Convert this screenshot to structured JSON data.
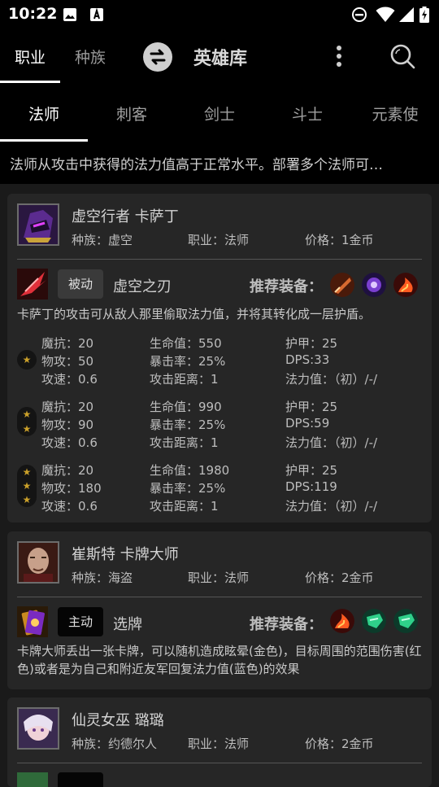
{
  "status_bar": {
    "time": "10:22"
  },
  "app_bar": {
    "segments": [
      "职业",
      "种族"
    ],
    "active_segment": "职业",
    "title": "英雄库"
  },
  "tabs": {
    "items": [
      "法师",
      "刺客",
      "剑士",
      "斗士",
      "元素使"
    ],
    "active": "法师"
  },
  "class_description": "法师从攻击中获得的法力值高于正常水平。部署多个法师可…",
  "labels": {
    "race": "种族：",
    "class": "职业：",
    "price": "价格：",
    "recommended": "推荐装备：",
    "mr": "魔抗：",
    "ad": "物攻：",
    "as": "攻速：",
    "hp": "生命值：",
    "crit": "暴击率：",
    "range": "攻击距离：",
    "armor": "护甲：",
    "dps": "DPS:",
    "mana": "法力值：",
    "star_glyph": "★"
  },
  "heroes": [
    {
      "name": "虚空行者  卡萨丁",
      "race": "虚空",
      "class": "法师",
      "price": "1金币",
      "skill_type": "被动",
      "skill_name": "虚空之刃",
      "skill_desc": "卡萨丁的攻击可从敌人那里偷取法力值，并将其转化成一层护盾。",
      "items": [
        "sword-item-icon",
        "purple-orb-item-icon",
        "flame-item-icon"
      ],
      "tiers": [
        {
          "stars": 1,
          "mr": "20",
          "ad": "50",
          "as": "0.6",
          "hp": "550",
          "crit": "25%",
          "range": "1",
          "armor": "25",
          "dps": "33",
          "mana": "（初）/-/"
        },
        {
          "stars": 2,
          "mr": "20",
          "ad": "90",
          "as": "0.6",
          "hp": "990",
          "crit": "25%",
          "range": "1",
          "armor": "25",
          "dps": "59",
          "mana": "（初）/-/"
        },
        {
          "stars": 3,
          "mr": "20",
          "ad": "180",
          "as": "0.6",
          "hp": "1980",
          "crit": "25%",
          "range": "1",
          "armor": "25",
          "dps": "119",
          "mana": "（初）/-/"
        }
      ]
    },
    {
      "name": "崔斯特  卡牌大师",
      "race": "海盗",
      "class": "法师",
      "price": "2金币",
      "skill_type": "主动",
      "skill_name": "选牌",
      "skill_desc": "卡牌大师丢出一张卡牌，可以随机造成眩晕(金色)，目标周围的范围伤害(红色)或者是为自己和附近友军回复法力值(蓝色)的效果",
      "items": [
        "flame-item-icon",
        "green-gauntlet-item-icon",
        "green-gauntlet-item-icon"
      ]
    },
    {
      "name": "仙灵女巫  璐璐",
      "race": "约德尔人",
      "class": "法师",
      "price": "2金币"
    }
  ],
  "colors": {
    "background": "#1a1a1a",
    "card": "#262626",
    "bar": "#000000",
    "star": "#caa02a"
  }
}
